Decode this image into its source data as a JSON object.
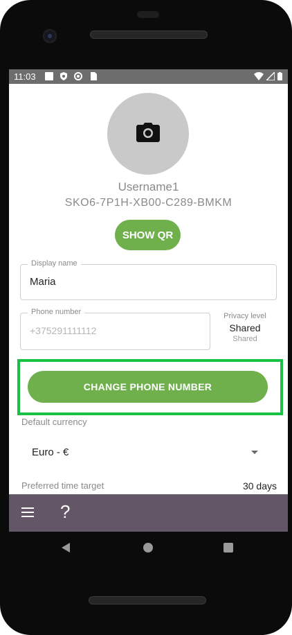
{
  "status_bar": {
    "time": "11:03",
    "icons": [
      "square-icon",
      "shield-icon",
      "at-icon",
      "sim-icon"
    ],
    "right_icons": [
      "wifi-icon",
      "signal-icon",
      "battery-icon"
    ]
  },
  "profile": {
    "username": "Username1",
    "user_id": "SKO6-7P1H-XB00-C289-BMKM",
    "show_qr_label": "SHOW QR"
  },
  "display_name": {
    "label": "Display name",
    "value": "Maria"
  },
  "phone": {
    "label": "Phone number",
    "placeholder": "+375291111112"
  },
  "privacy": {
    "label": "Privacy level",
    "value": "Shared",
    "subvalue": "Shared"
  },
  "change_phone_label": "CHANGE PHONE NUMBER",
  "currency": {
    "label": "Default currency",
    "selected": "Euro - €"
  },
  "time_target": {
    "label": "Preferred time target",
    "value": "30 days"
  },
  "bottom_bar": {
    "help": "?"
  },
  "colors": {
    "accent_green": "#6fb04d",
    "highlight_green": "#19c046",
    "bottom_bar": "#625667",
    "status_bar": "#6d6d6d"
  }
}
